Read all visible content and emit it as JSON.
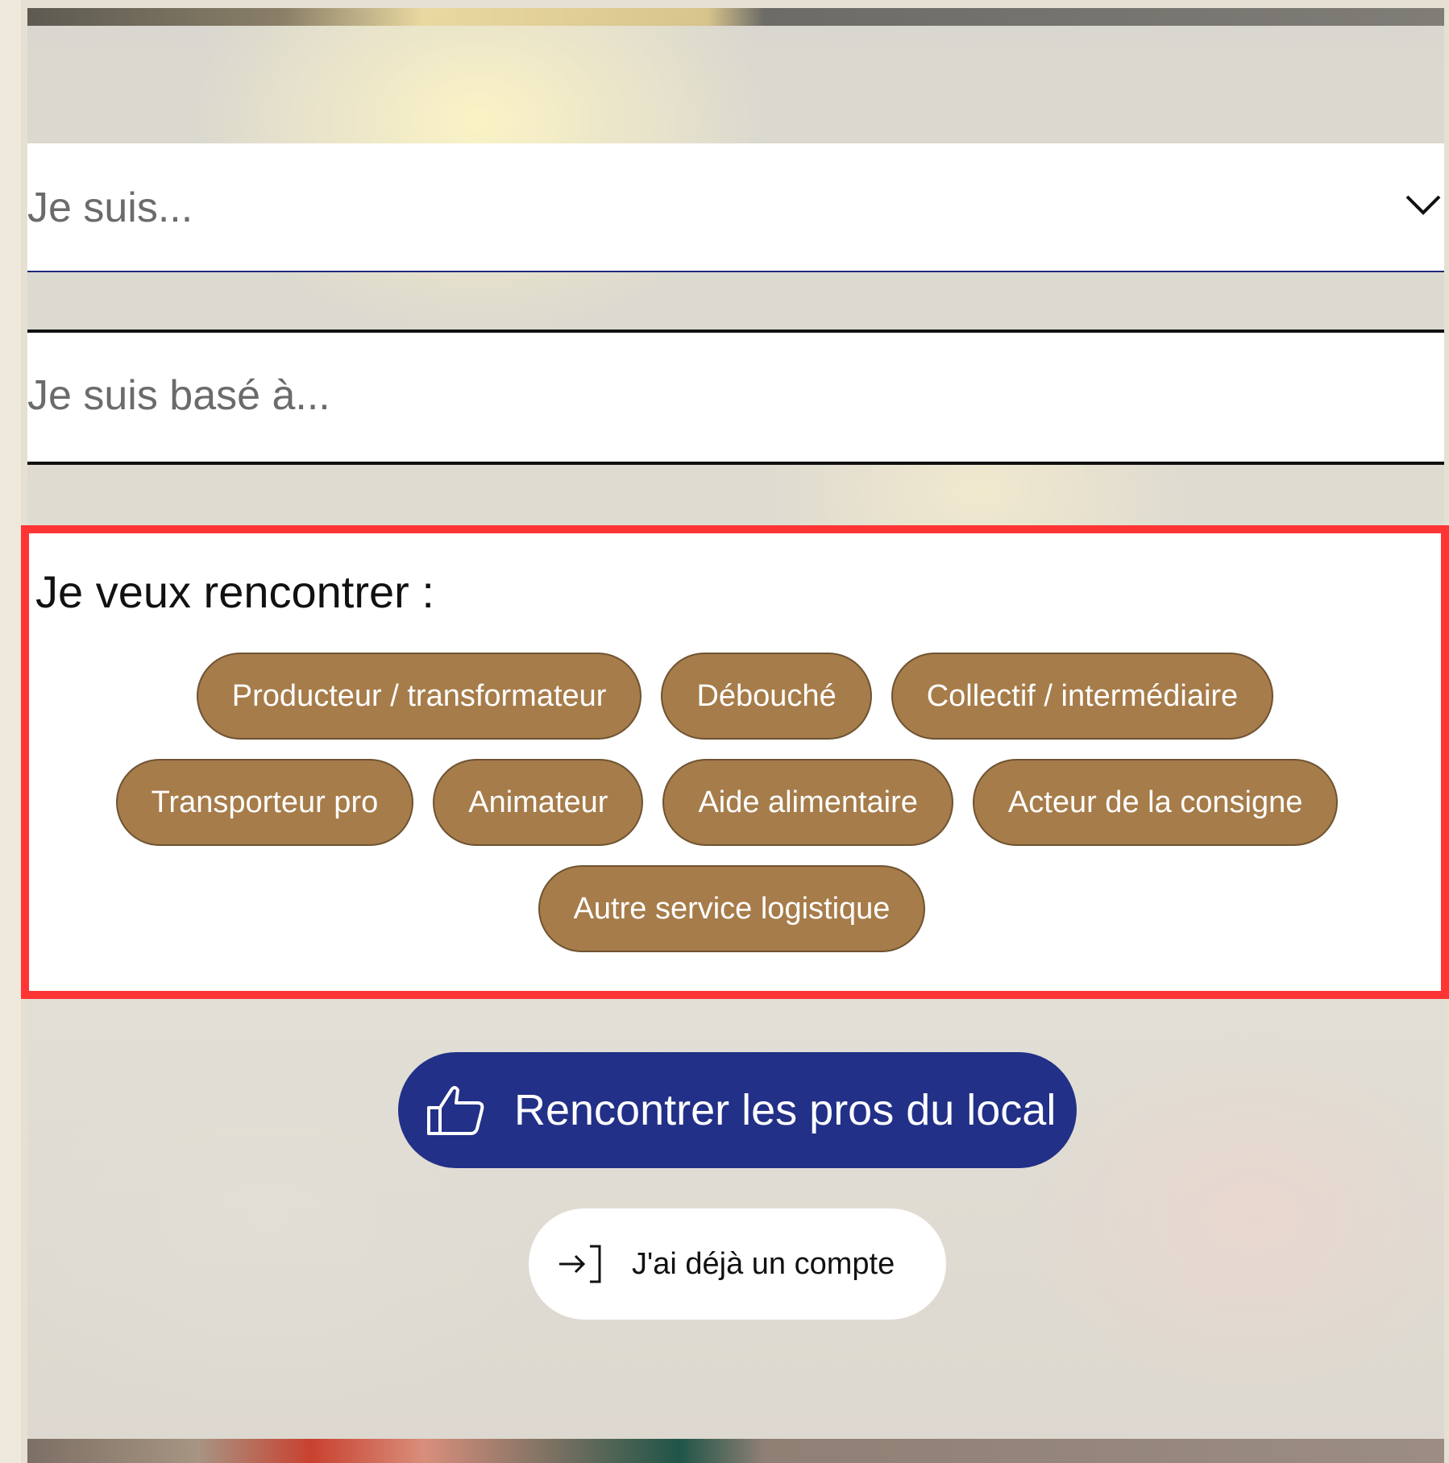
{
  "form": {
    "role_select": {
      "placeholder": "Je suis...",
      "icon": "chevron-down-icon"
    },
    "location_input": {
      "placeholder": "Je suis basé à..."
    }
  },
  "meet": {
    "title": "Je veux rencontrer :",
    "options": [
      [
        "Producteur / transformateur",
        "Débouché",
        "Collectif / intermédiaire"
      ],
      [
        "Transporteur pro",
        "Animateur",
        "Aide alimentaire",
        "Acteur de la consigne"
      ],
      [
        "Autre service logistique"
      ]
    ],
    "highlight_color": "#ff3434",
    "chip_color": "#a67c4a"
  },
  "actions": {
    "primary_label": "Rencontrer les pros du local",
    "primary_icon": "thumbs-up-icon",
    "primary_color": "#223088",
    "secondary_label": "J'ai déjà un compte",
    "secondary_icon": "login-icon"
  }
}
